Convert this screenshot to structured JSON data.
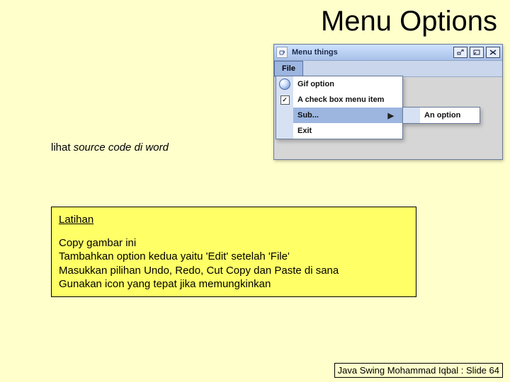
{
  "slide": {
    "title": "Menu Options",
    "note_prefix": "lihat ",
    "note_italic": "source code di word",
    "footer": "Java Swing Mohammad Iqbal : Slide 64"
  },
  "window": {
    "title": "Menu things",
    "menubar": {
      "file": "File"
    },
    "menu": {
      "gif_option": "Gif option",
      "checkbox_item": "A check box menu item",
      "checkbox_checked": "✓",
      "sub_label": "Sub...",
      "exit": "Exit"
    },
    "submenu": {
      "an_option": "An option"
    }
  },
  "exercise": {
    "title": "Latihan",
    "line1": "Copy gambar ini",
    "line2": "Tambahkan option kedua yaitu 'Edit' setelah 'File'",
    "line3": "Masukkan pilihan Undo, Redo, Cut Copy dan Paste di sana",
    "line4": "Gunakan icon yang tepat jika memungkinkan"
  }
}
